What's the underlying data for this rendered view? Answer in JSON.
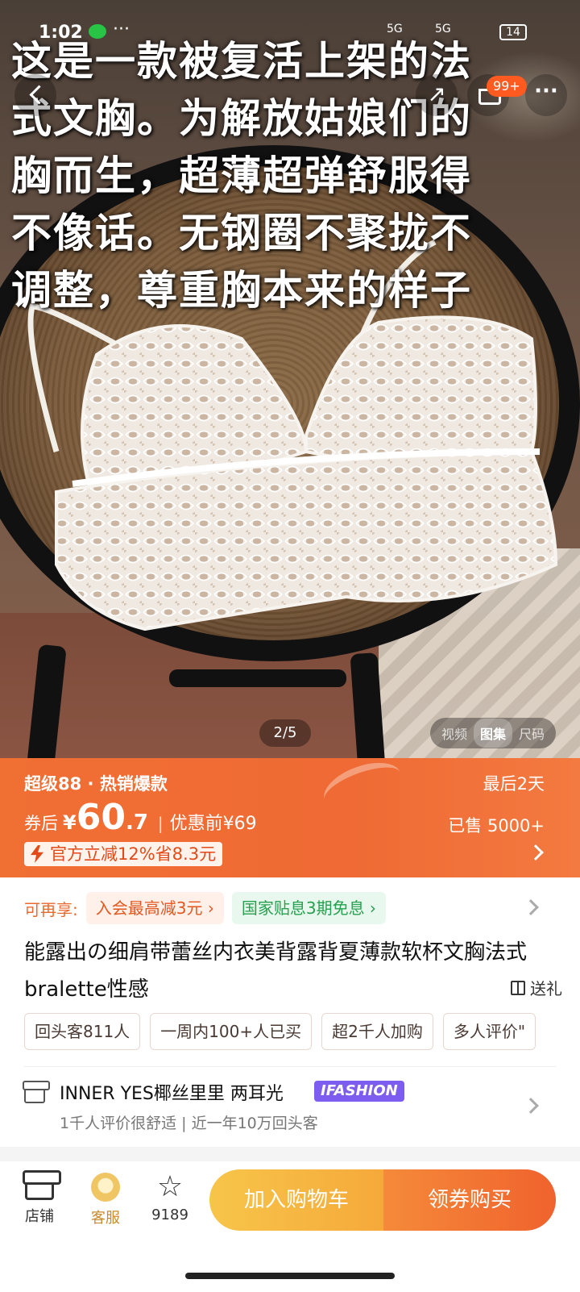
{
  "status_bar": {
    "time": "1:02",
    "network1": "5G",
    "network2": "5G",
    "battery": "14"
  },
  "top_nav": {
    "cart_badge": "99+"
  },
  "hero": {
    "caption_lines": [
      "这是一款被复活上架的法",
      "式文胸。为解放姑娘们的",
      "胸而生，超薄超弹舒服得",
      "不像话。无钢圈不聚拢不",
      "调整，尊重胸本来的样子"
    ],
    "pager": "2/5",
    "media_tabs": [
      "视频",
      "图集",
      "尺码"
    ],
    "active_tab": "图集"
  },
  "promo": {
    "tagline": "超级88 · 热销爆款",
    "countdown": "最后2天",
    "after_coupon_label": "券后",
    "currency": "¥",
    "price_int": "60",
    "price_dec": ".7",
    "separator": "|",
    "original_price": "优惠前¥69",
    "sold": "已售 5000+",
    "official_discount": "官方立减12%省8.3元",
    "bg_color": "#ef6a34"
  },
  "benefits": {
    "label": "可再享:",
    "chips": [
      "入会最高减3元 ›",
      "国家贴息3期免息 ›"
    ]
  },
  "product": {
    "title": "能露出の细肩带蕾丝内衣美背露背夏薄款软杯文胸法式bralette性感",
    "gift": "送礼",
    "tags": [
      "回头客811人",
      "一周内100+人已买",
      "超2千人加购",
      "多人评价\""
    ]
  },
  "store": {
    "name": "INNER YES椰丝里里 两耳光",
    "badge": "IFASHION",
    "stats": "1千人评价很舒适 | 近一年10万回头客"
  },
  "bottom_bar": {
    "shop_label": "店铺",
    "service_label": "客服",
    "fav_count": "9189",
    "add_cart_label": "加入购物车",
    "buy_label": "领券购买"
  }
}
